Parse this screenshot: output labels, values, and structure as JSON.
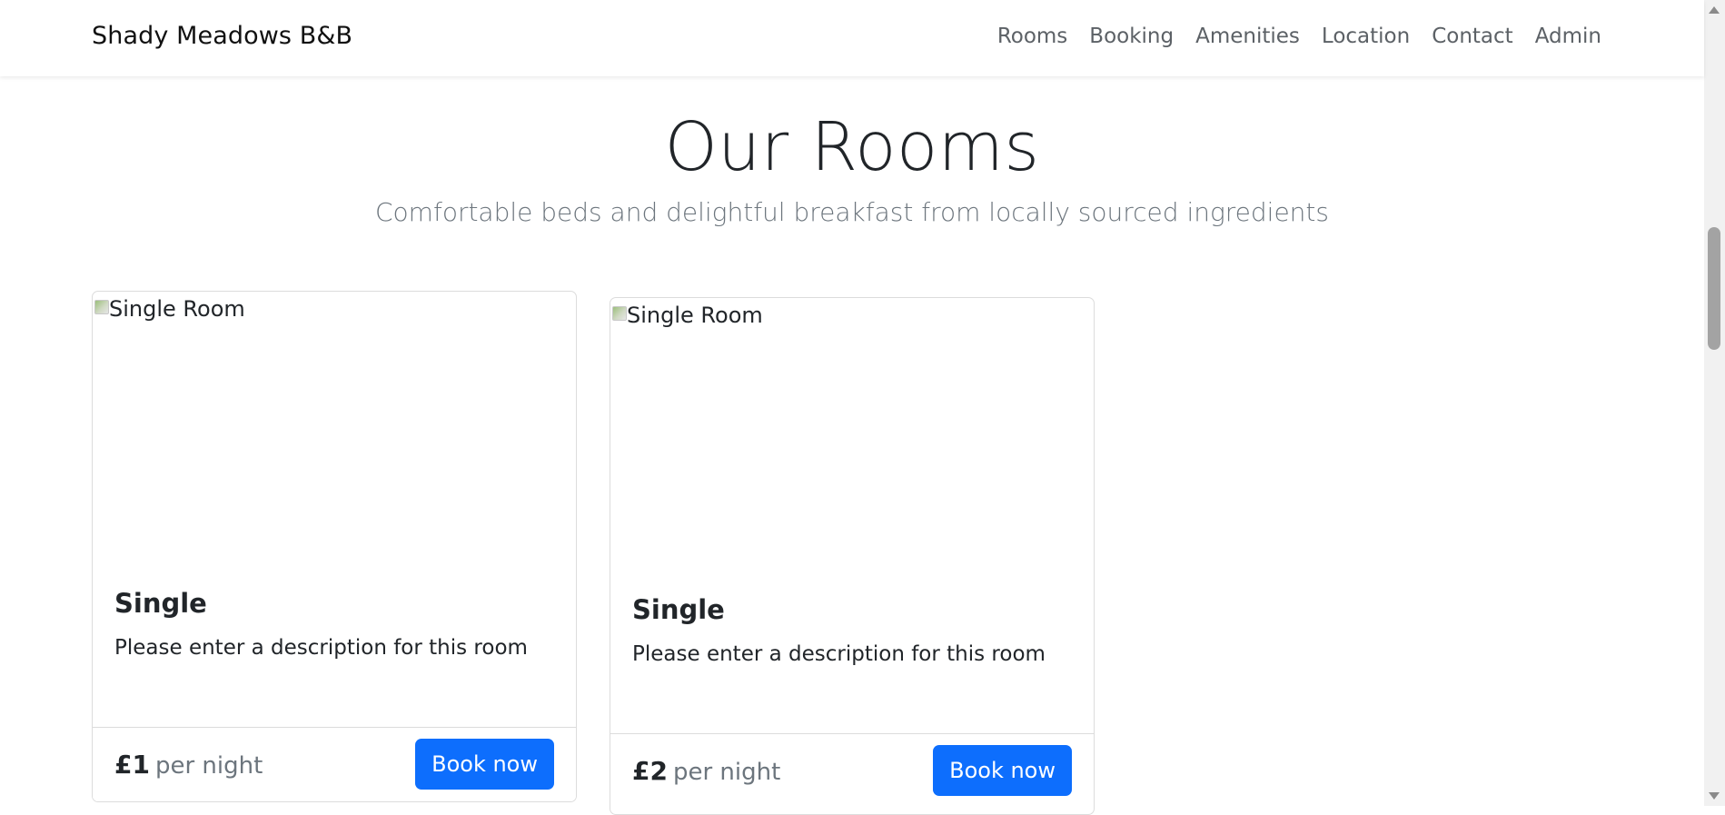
{
  "navbar": {
    "brand": "Shady Meadows B&B",
    "links": [
      "Rooms",
      "Booking",
      "Amenities",
      "Location",
      "Contact",
      "Admin"
    ]
  },
  "section": {
    "title": "Our Rooms",
    "subtitle": "Comfortable beds and delightful breakfast from locally sourced ingredients"
  },
  "rooms": [
    {
      "image_alt": "Single Room",
      "name": "Single",
      "description": "Please enter a description for this room",
      "price": "£1",
      "per_night": "per night",
      "button_label": "Book now"
    },
    {
      "image_alt": "Single Room",
      "name": "Single",
      "description": "Please enter a description for this room",
      "price": "£2",
      "per_night": "per night",
      "button_label": "Book now"
    }
  ],
  "colors": {
    "primary": "#0d6efd",
    "muted": "#6c757d",
    "text": "#212529"
  }
}
